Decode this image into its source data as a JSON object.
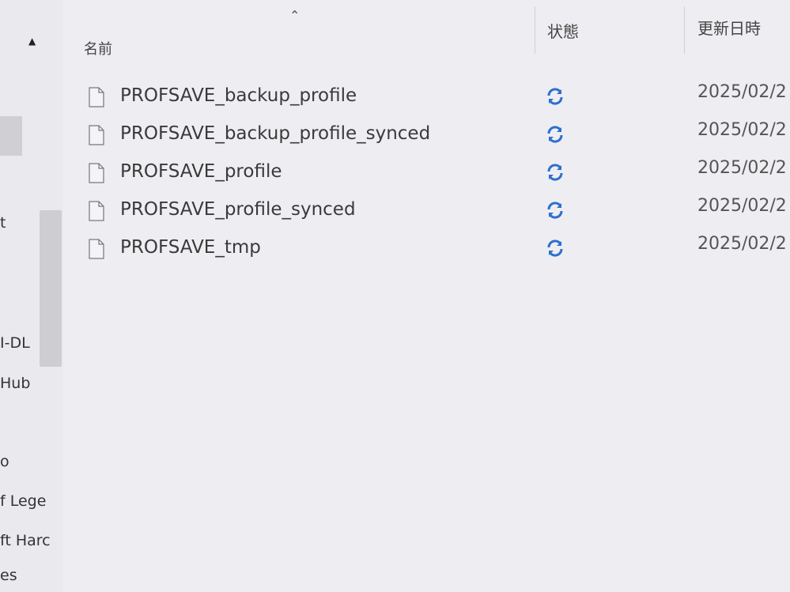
{
  "nav": {
    "items": [
      "t",
      "I-DL",
      "Hub",
      "o",
      "f Lege",
      "ft Harc",
      "es"
    ]
  },
  "header": {
    "name": "名前",
    "status": "状態",
    "modified": "更新日時"
  },
  "files": [
    {
      "name": "PROFSAVE_backup_profile",
      "date": "2025/02/2"
    },
    {
      "name": "PROFSAVE_backup_profile_synced",
      "date": "2025/02/2"
    },
    {
      "name": "PROFSAVE_profile",
      "date": "2025/02/2"
    },
    {
      "name": "PROFSAVE_profile_synced",
      "date": "2025/02/2"
    },
    {
      "name": "PROFSAVE_tmp",
      "date": "2025/02/2"
    }
  ],
  "colors": {
    "sync_icon": "#2f6fcf",
    "text": "#3a3a3a"
  },
  "icons": {
    "file": "file-icon",
    "status": "sync-icon",
    "sort": "chevron-up-icon"
  }
}
